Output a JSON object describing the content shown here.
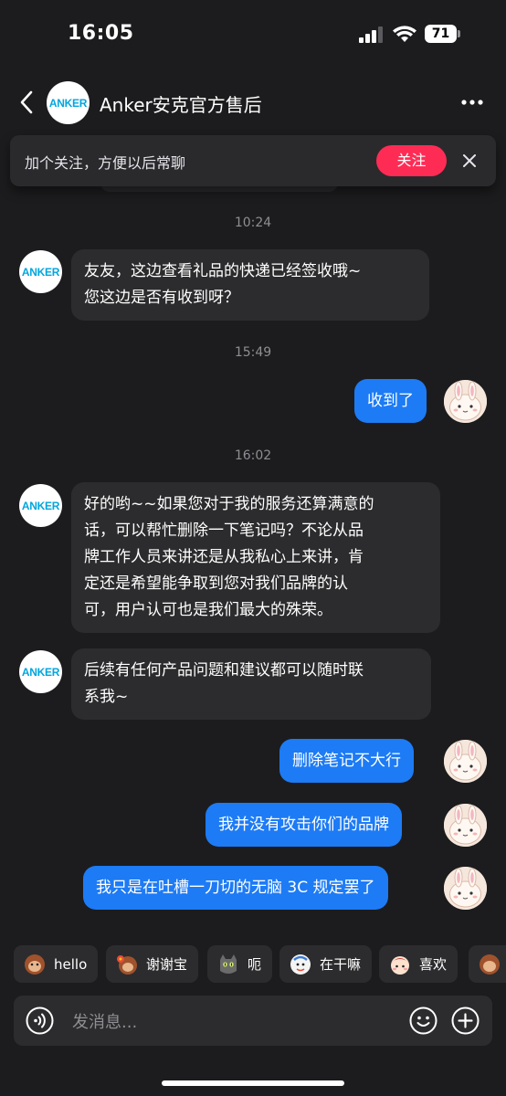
{
  "status_bar": {
    "time": "16:05",
    "battery": "71"
  },
  "header": {
    "title": "Anker安克官方售后",
    "logo_text": "ANKER"
  },
  "follow_banner": {
    "text": "加个关注，方便以后常聊",
    "button": "关注"
  },
  "conversation": {
    "ts1": "10:24",
    "msg1_line1": "友友，这边查看礼品的快递已经签收哦~",
    "msg1_line2": "您这边是否有收到呀？",
    "ts2": "15:49",
    "msg2": "收到了",
    "ts3": "16:02",
    "msg3_line1": "好的哟~~如果您对于我的服务还算满意的",
    "msg3_line2": "话，可以帮忙删除一下笔记吗？不论从品",
    "msg3_line3": "牌工作人员来讲还是从我私心上来讲，肯",
    "msg3_line4": "定还是希望能争取到您对我们品牌的认",
    "msg3_line5": "可，用户认可也是我们最大的殊荣。",
    "msg4_line1": "后续有任何产品问题和建议都可以随时联",
    "msg4_line2": "系我~",
    "msg5": "删除笔记不大行",
    "msg6": "我并没有攻击你们的品牌",
    "msg7": "我只是在吐槽一刀切的无脑 3C 规定罢了"
  },
  "quick_replies": [
    "hello",
    "谢谢宝",
    "呃",
    "在干嘛",
    "喜欢"
  ],
  "input": {
    "placeholder": "发消息..."
  },
  "colors": {
    "background": "#1c1c1e",
    "bubble_in": "#2c2c2e",
    "bubble_out": "#1d7bf5",
    "follow": "#fe2c55",
    "anker_blue": "#00a6de"
  },
  "icons": [
    "back-arrow-icon",
    "more-dots-icon",
    "close-icon",
    "voice-icon",
    "emoji-icon",
    "plus-icon"
  ]
}
